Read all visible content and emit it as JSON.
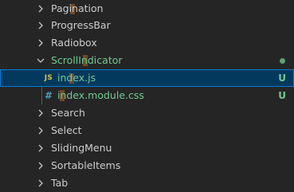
{
  "explorer": {
    "git_color": "#73c991",
    "items": [
      {
        "label": "Pagination",
        "type": "folder",
        "state": "collapsed"
      },
      {
        "label": "ProgressBar",
        "type": "folder",
        "state": "collapsed"
      },
      {
        "label": "Radiobox",
        "type": "folder",
        "state": "collapsed"
      },
      {
        "label": "ScrollIndicator",
        "type": "folder",
        "state": "expanded",
        "status": "modified-dot"
      },
      {
        "label": "index.js",
        "type": "file",
        "icon": "JS",
        "icon_name": "javascript-file-icon",
        "status": "U",
        "selected": true
      },
      {
        "label": "index.module.css",
        "type": "file",
        "icon": "#",
        "icon_name": "css-file-icon",
        "status": "U"
      },
      {
        "label": "Search",
        "type": "folder",
        "state": "collapsed"
      },
      {
        "label": "Select",
        "type": "folder",
        "state": "collapsed"
      },
      {
        "label": "SlidingMenu",
        "type": "folder",
        "state": "collapsed"
      },
      {
        "label": "SortableItems",
        "type": "folder",
        "state": "collapsed"
      },
      {
        "label": "Tab",
        "type": "folder",
        "state": "collapsed"
      }
    ]
  }
}
